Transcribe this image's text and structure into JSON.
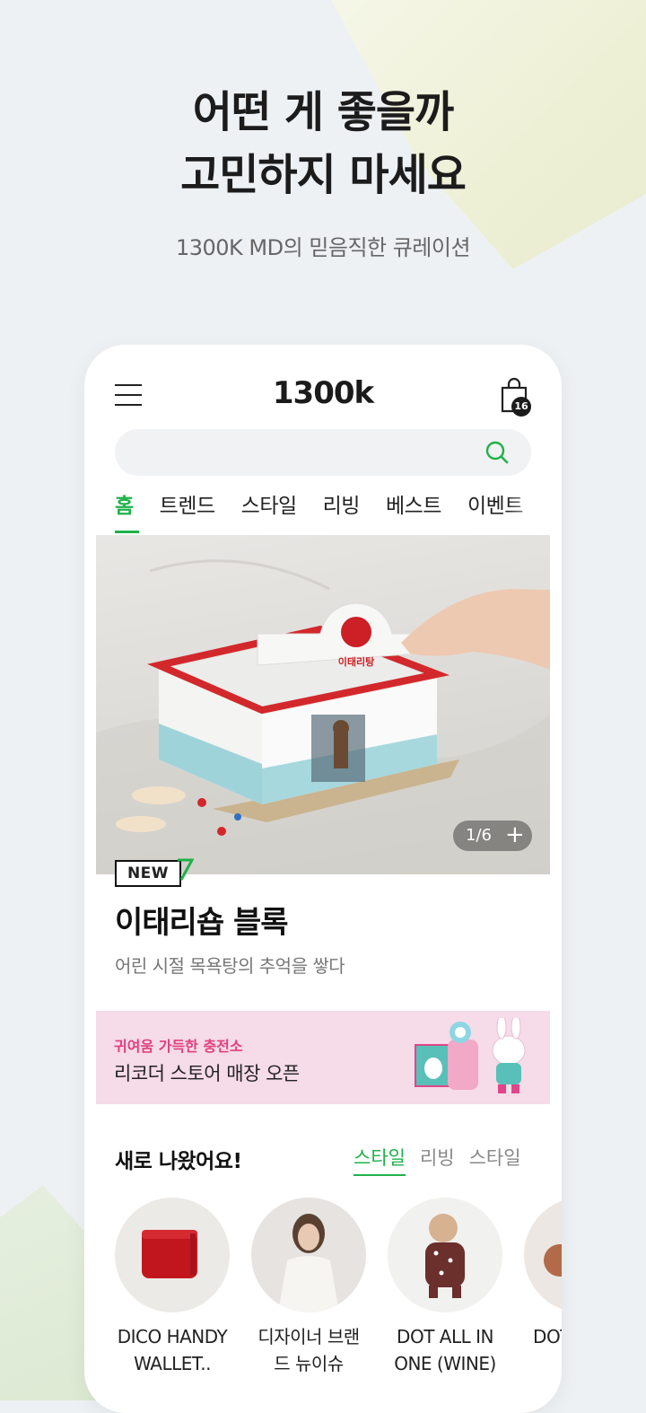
{
  "promo": {
    "headline_line1": "어떤 게 좋을까",
    "headline_line2": "고민하지 마세요",
    "subhead": "1300K MD의 믿음직한 큐레이션"
  },
  "app": {
    "logo": "1300k",
    "cart_count": "16",
    "search_placeholder": "",
    "tabs": [
      {
        "label": "홈",
        "active": true
      },
      {
        "label": "트렌드"
      },
      {
        "label": "스타일"
      },
      {
        "label": "리빙"
      },
      {
        "label": "베스트"
      },
      {
        "label": "이벤트"
      }
    ],
    "hero": {
      "counter": "1/6",
      "sign_text": "이태리탕",
      "badge": "NEW",
      "title": "이태리숍 블록",
      "description": "어린 시절 목욕탕의 추억을 쌓다"
    },
    "banner": {
      "small_text": "귀여움 가득한 충전소",
      "main_text": "리코더 스토어 매장 오픈"
    },
    "new_section": {
      "title": "새로 나왔어요!",
      "filters": [
        {
          "label": "스타일",
          "active": true
        },
        {
          "label": "리빙"
        },
        {
          "label": "스타일"
        }
      ],
      "products": [
        {
          "name": "DICO HANDY WALLET.."
        },
        {
          "name": "디자이너 브랜드 뉴이슈"
        },
        {
          "name": "DOT ALL IN ONE (WINE)"
        },
        {
          "name": "DOT ALL IN ONE"
        }
      ]
    },
    "colors": {
      "accent": "#1fb24a",
      "banner_bg": "#f6dbe8",
      "banner_highlight": "#e2407f"
    }
  }
}
